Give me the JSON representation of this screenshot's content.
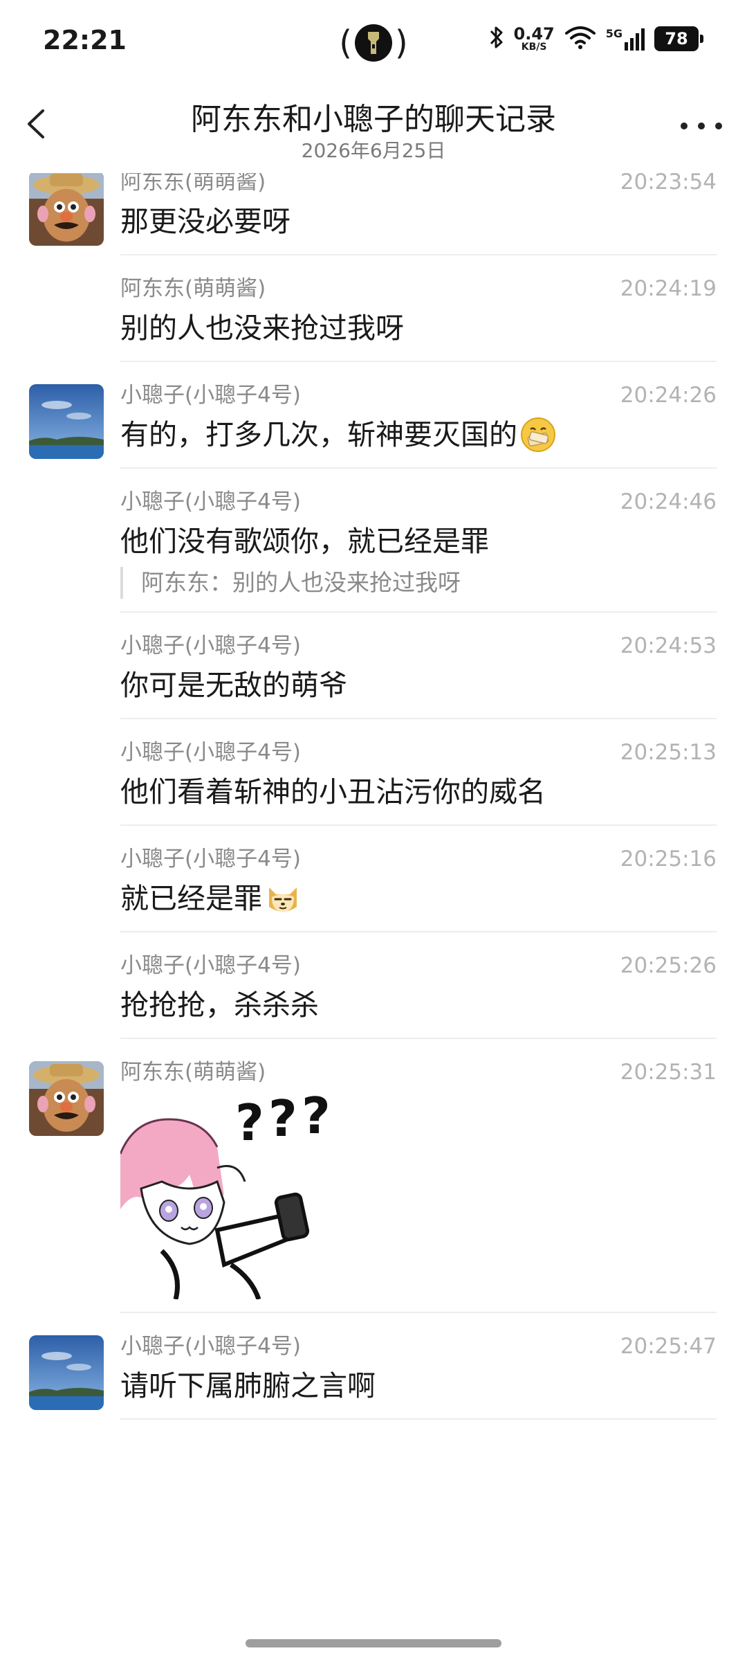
{
  "status_bar": {
    "time": "22:21",
    "net_speed_value": "0.47",
    "net_speed_unit": "KB/S",
    "network_type": "5G",
    "battery": "78"
  },
  "header": {
    "title": "阿东东和小聰子的聊天记录",
    "subtitle": "2026年6月25日"
  },
  "messages": [
    {
      "sender": "阿东东(萌萌酱)",
      "time": "20:23:54",
      "text": "那更没必要呀",
      "avatar": "potato"
    },
    {
      "sender": "阿东东(萌萌酱)",
      "time": "20:24:19",
      "text": "别的人也没来抢过我呀",
      "avatar": ""
    },
    {
      "sender": "小聰子(小聰子4号)",
      "time": "20:24:26",
      "text": "有的，打多几次，斩神要灭国的",
      "emoji": "mouth-zipped-emoji",
      "avatar": "sky"
    },
    {
      "sender": "小聰子(小聰子4号)",
      "time": "20:24:46",
      "text": "他们没有歌颂你，就已经是罪",
      "quote": "阿东东：别的人也没来抢过我呀",
      "avatar": ""
    },
    {
      "sender": "小聰子(小聰子4号)",
      "time": "20:24:53",
      "text": "你可是无敌的萌爷",
      "avatar": ""
    },
    {
      "sender": "小聰子(小聰子4号)",
      "time": "20:25:13",
      "text": "他们看着斩神的小丑沾污你的威名",
      "avatar": ""
    },
    {
      "sender": "小聰子(小聰子4号)",
      "time": "20:25:16",
      "text": "就已经是罪",
      "emoji": "doge-emoji",
      "avatar": ""
    },
    {
      "sender": "小聰子(小聰子4号)",
      "time": "20:25:26",
      "text": "抢抢抢，杀杀杀",
      "avatar": ""
    },
    {
      "sender": "阿东东(萌萌酱)",
      "time": "20:25:31",
      "text": "",
      "sticker": "confused-anime-girl-sticker",
      "avatar": "potato"
    },
    {
      "sender": "小聰子(小聰子4号)",
      "time": "20:25:47",
      "text": "请听下属肺腑之言啊",
      "avatar": "sky"
    }
  ],
  "colors": {
    "sender_text": "#8a8a8a",
    "time_text": "#b3b3b3",
    "divider": "#ededed"
  }
}
